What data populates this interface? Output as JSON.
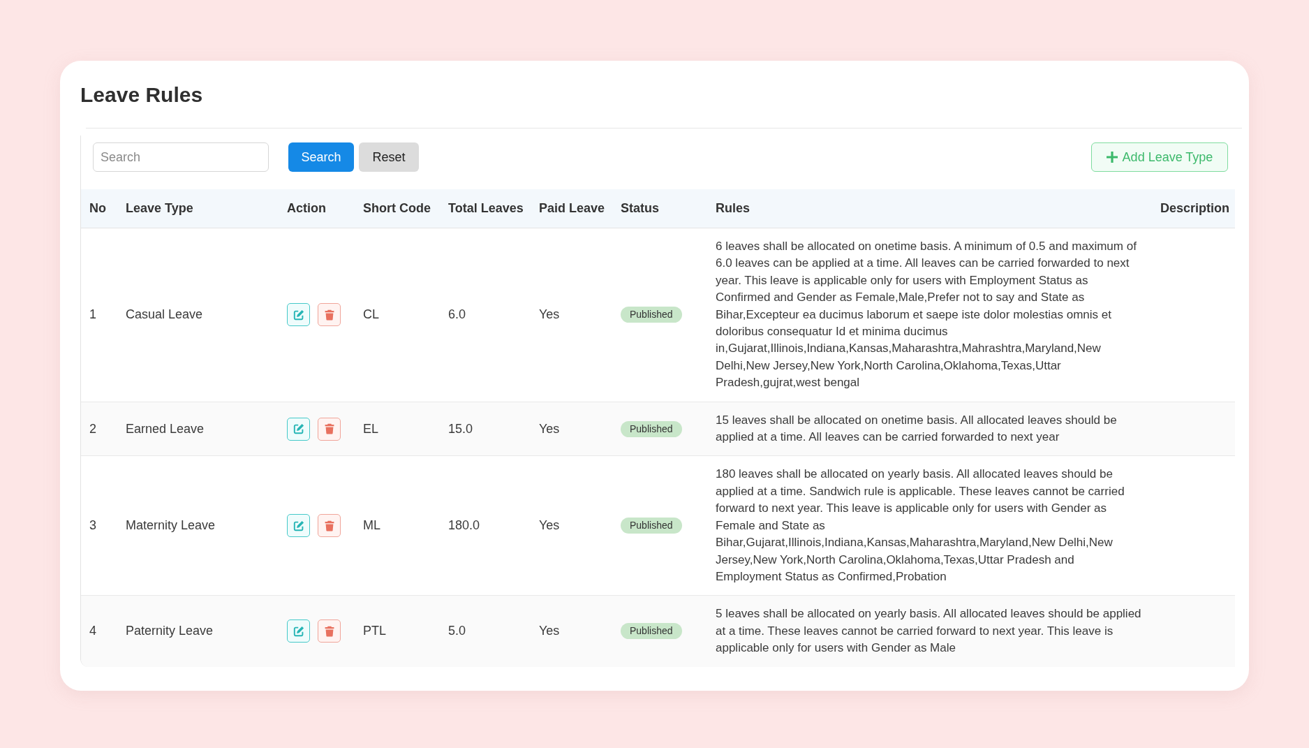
{
  "title": "Leave Rules",
  "toolbar": {
    "search": {
      "placeholder": "Search"
    },
    "buttons": [
      {
        "label": "Search",
        "kind": "primary"
      },
      {
        "label": "Reset",
        "kind": "secondary"
      }
    ],
    "add_button": {
      "label": "Add Leave Type"
    }
  },
  "table": {
    "columns": [
      "No",
      "Leave Type",
      "Action",
      "Short Code",
      "Total Leaves",
      "Paid Leave",
      "Status",
      "Rules",
      "Description"
    ],
    "rows": [
      {
        "no": "1",
        "leave_type": "Casual Leave",
        "short_code": "CL",
        "total_leaves": "6.0",
        "paid_leave": "Yes",
        "status": "Published",
        "rules": "6 leaves shall be allocated on onetime basis. A minimum of 0.5 and maximum of 6.0 leaves can be applied at a time. All leaves can be carried forwarded to next year. This leave is applicable only for users with Employment Status as Confirmed and Gender as Female,Male,Prefer not to say and State as Bihar,Excepteur ea ducimus laborum et saepe iste dolor molestias omnis et doloribus consequatur Id et minima ducimus in,Gujarat,Illinois,Indiana,Kansas,Maharashtra,Mahrashtra,Maryland,New Delhi,New Jersey,New York,North Carolina,Oklahoma,Texas,Uttar Pradesh,gujrat,west bengal"
      },
      {
        "no": "2",
        "leave_type": "Earned Leave",
        "short_code": "EL",
        "total_leaves": "15.0",
        "paid_leave": "Yes",
        "status": "Published",
        "rules": "15 leaves shall be allocated on onetime basis. All allocated leaves should be applied at a time. All leaves can be carried forwarded to next year"
      },
      {
        "no": "3",
        "leave_type": "Maternity Leave",
        "short_code": "ML",
        "total_leaves": "180.0",
        "paid_leave": "Yes",
        "status": "Published",
        "rules": "180 leaves shall be allocated on yearly basis. All allocated leaves should be applied at a time. Sandwich rule is applicable. These leaves cannot be carried forward to next year. This leave is applicable only for users with Gender as Female and State as Bihar,Gujarat,Illinois,Indiana,Kansas,Maharashtra,Maryland,New Delhi,New Jersey,New York,North Carolina,Oklahoma,Texas,Uttar Pradesh and Employment Status as Confirmed,Probation"
      },
      {
        "no": "4",
        "leave_type": "Paternity Leave",
        "short_code": "PTL",
        "total_leaves": "5.0",
        "paid_leave": "Yes",
        "status": "Published",
        "rules": "5 leaves shall be allocated on yearly basis. All allocated leaves should be applied at a time. These leaves cannot be carried forward to next year. This leave is applicable only for users with Gender as Male"
      }
    ]
  }
}
